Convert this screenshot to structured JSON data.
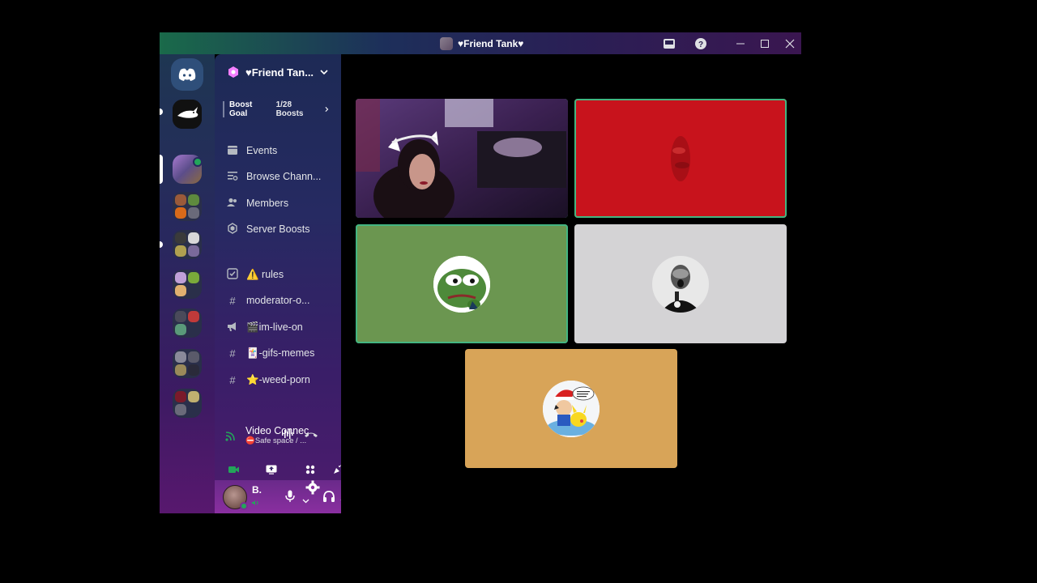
{
  "window": {
    "title": "♥Friend Tank♥",
    "buttons": [
      "inbox-icon",
      "help-icon",
      "minimize-icon",
      "maximize-icon",
      "close-icon"
    ]
  },
  "server": {
    "name": "♥Friend Tan...",
    "boost_goal_label": "Boost Goal",
    "boost_progress": "1/28 Boosts"
  },
  "menu": [
    {
      "icon": "calendar-icon",
      "label": "Events"
    },
    {
      "icon": "browse-channels-icon",
      "label": "Browse Chann..."
    },
    {
      "icon": "members-icon",
      "label": "Members"
    },
    {
      "icon": "server-boost-icon",
      "label": "Server Boosts"
    }
  ],
  "channels": [
    {
      "icon": "rules-icon",
      "label": "⚠️ rules"
    },
    {
      "icon": "hash-icon",
      "label": "moderator-o..."
    },
    {
      "icon": "announcement-icon",
      "label": "🎬im-live-on"
    },
    {
      "icon": "hash-icon",
      "label": "🃏-gifs-memes"
    },
    {
      "icon": "hash-icon",
      "label": "⭐-weed-porn"
    }
  ],
  "voice": {
    "status": "Video Connec",
    "channel": "⛔Safe space / ..."
  },
  "user": {
    "name": "B.",
    "status_color": "#23a55a"
  },
  "video_tiles": [
    {
      "name": "webcam-tile",
      "speaking": true,
      "bg": "#2a1a35"
    },
    {
      "name": "red-video-tile",
      "speaking": true,
      "bg": "#c8131c"
    },
    {
      "name": "pepe-avatar-tile",
      "speaking": true,
      "bg": "#6b9650"
    },
    {
      "name": "bw-avatar-tile",
      "speaking": false,
      "bg": "#d4d3d5"
    },
    {
      "name": "ash-pikachu-avatar-tile",
      "speaking": false,
      "bg": "#d8a458"
    }
  ],
  "colors": {
    "speaking_outline": "#43b581",
    "accent": "#5865f2"
  }
}
